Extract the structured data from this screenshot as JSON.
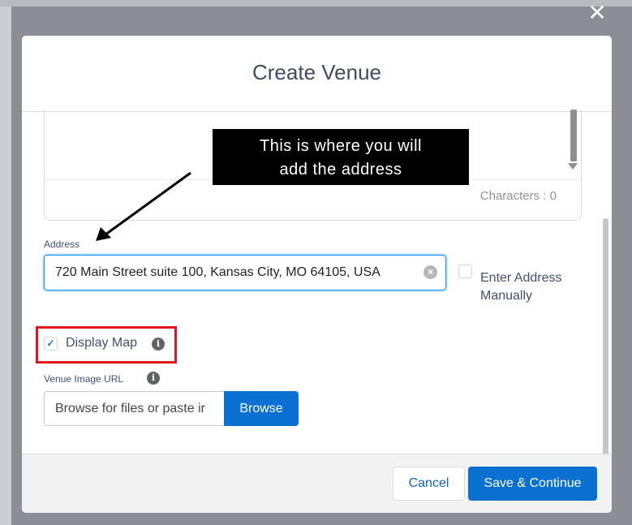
{
  "modal": {
    "title": "Create Venue",
    "close_glyph": "✕"
  },
  "description": {
    "char_count": "Characters : 0"
  },
  "address": {
    "label": "Address",
    "value": "720 Main Street suite 100, Kansas City, MO 64105, USA",
    "clear_icon": "×",
    "manual_checked": false,
    "manual_label_line1": "Enter Address",
    "manual_label_line2": "Manually"
  },
  "display_map": {
    "checked": true,
    "check_glyph": "✓",
    "label": "Display Map",
    "info_glyph": "i"
  },
  "venue_image": {
    "label": "Venue Image URL",
    "info_glyph": "i",
    "placeholder": "Browse for files or paste ir",
    "browse_label": "Browse"
  },
  "footer": {
    "cancel_label": "Cancel",
    "save_label": "Save & Continue"
  },
  "annotation": {
    "line1": "This is where you will",
    "line2": "add the address",
    "highlight_color": "#e0161c"
  },
  "colors": {
    "brand_blue": "#0a70d2",
    "focus_blue": "#1b96ff"
  }
}
